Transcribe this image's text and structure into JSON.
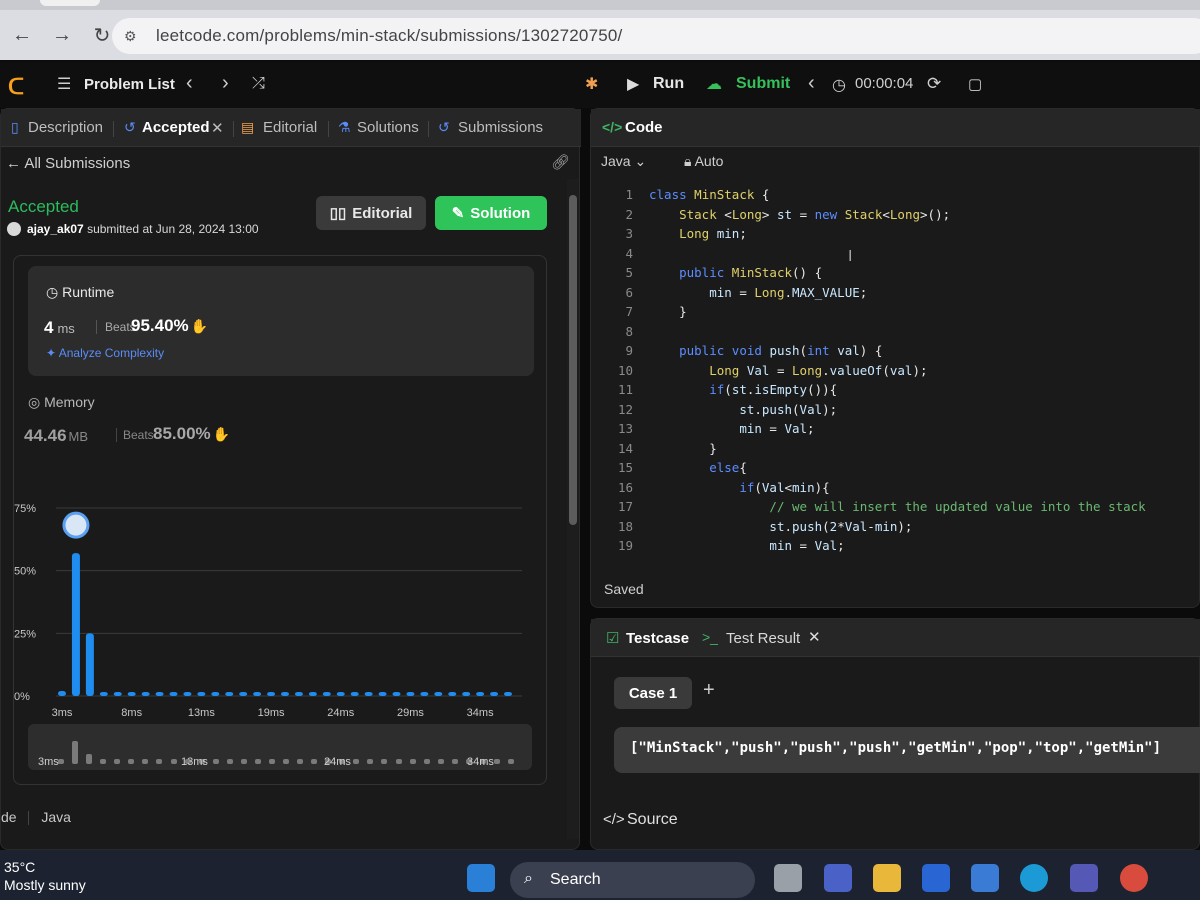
{
  "browser": {
    "url": "leetcode.com/problems/min-stack/submissions/1302720750/"
  },
  "header": {
    "problem_list": "Problem List",
    "run": "Run",
    "submit": "Submit",
    "timer": "00:00:04"
  },
  "left_tabs": {
    "description": "Description",
    "accepted": "Accepted",
    "editorial": "Editorial",
    "solutions": "Solutions",
    "submissions": "Submissions"
  },
  "submission": {
    "back": "All Submissions",
    "status": "Accepted",
    "user": "ajay_ak07",
    "submitted_text": "submitted at Jun 28, 2024 13:00",
    "editorial_btn": "Editorial",
    "solution_btn": "Solution"
  },
  "runtime": {
    "title": "Runtime",
    "value": "4",
    "unit": "ms",
    "beats_label": "Beats",
    "beats": "95.40%",
    "analyze": "Analyze Complexity"
  },
  "memory": {
    "title": "Memory",
    "value": "44.46",
    "unit": "MB",
    "beats_label": "Beats",
    "beats": "85.00%"
  },
  "chart_data": {
    "type": "bar",
    "y_ticks": [
      "75%",
      "50%",
      "25%",
      "0%"
    ],
    "ylim": [
      0,
      75
    ],
    "x_tick_labels": [
      "3ms",
      "8ms",
      "13ms",
      "19ms",
      "24ms",
      "29ms",
      "34ms"
    ],
    "values": [
      2,
      57,
      25,
      1,
      1,
      1,
      1,
      1,
      1,
      1,
      1,
      1,
      1,
      1,
      1,
      1,
      1,
      1,
      1,
      1,
      1,
      1,
      1,
      1,
      1,
      1,
      1,
      1,
      1,
      1,
      1,
      1,
      1
    ],
    "highlight_index": 1,
    "mini_labels": [
      "3ms",
      "13ms",
      "24ms",
      "34ms"
    ]
  },
  "left_footer": {
    "prefix": "de",
    "lang": "Java"
  },
  "code_panel": {
    "title": "Code",
    "lang": "Java",
    "mode": "Auto",
    "saved": "Saved",
    "lines": [
      "class MinStack {",
      "    Stack <Long> st = new Stack<Long>();",
      "    Long min;",
      "",
      "    public MinStack() {",
      "        min = Long.MAX_VALUE;",
      "    }",
      "",
      "    public void push(int val) {",
      "        Long Val = Long.valueOf(val);",
      "        if(st.isEmpty()){",
      "            st.push(Val);",
      "            min = Val;",
      "        }",
      "        else{",
      "            if(Val<min){",
      "                // we will insert the updated value into the stack",
      "                st.push(2*Val-min);",
      "                min = Val;"
    ]
  },
  "test_panel": {
    "testcase": "Testcase",
    "test_result": "Test Result",
    "case": "Case 1",
    "input": "[\"MinStack\",\"push\",\"push\",\"push\",\"getMin\",\"pop\",\"top\",\"getMin\"]",
    "source": "Source"
  },
  "taskbar": {
    "temp": "35°C",
    "condition": "Mostly sunny",
    "search": "Search"
  }
}
